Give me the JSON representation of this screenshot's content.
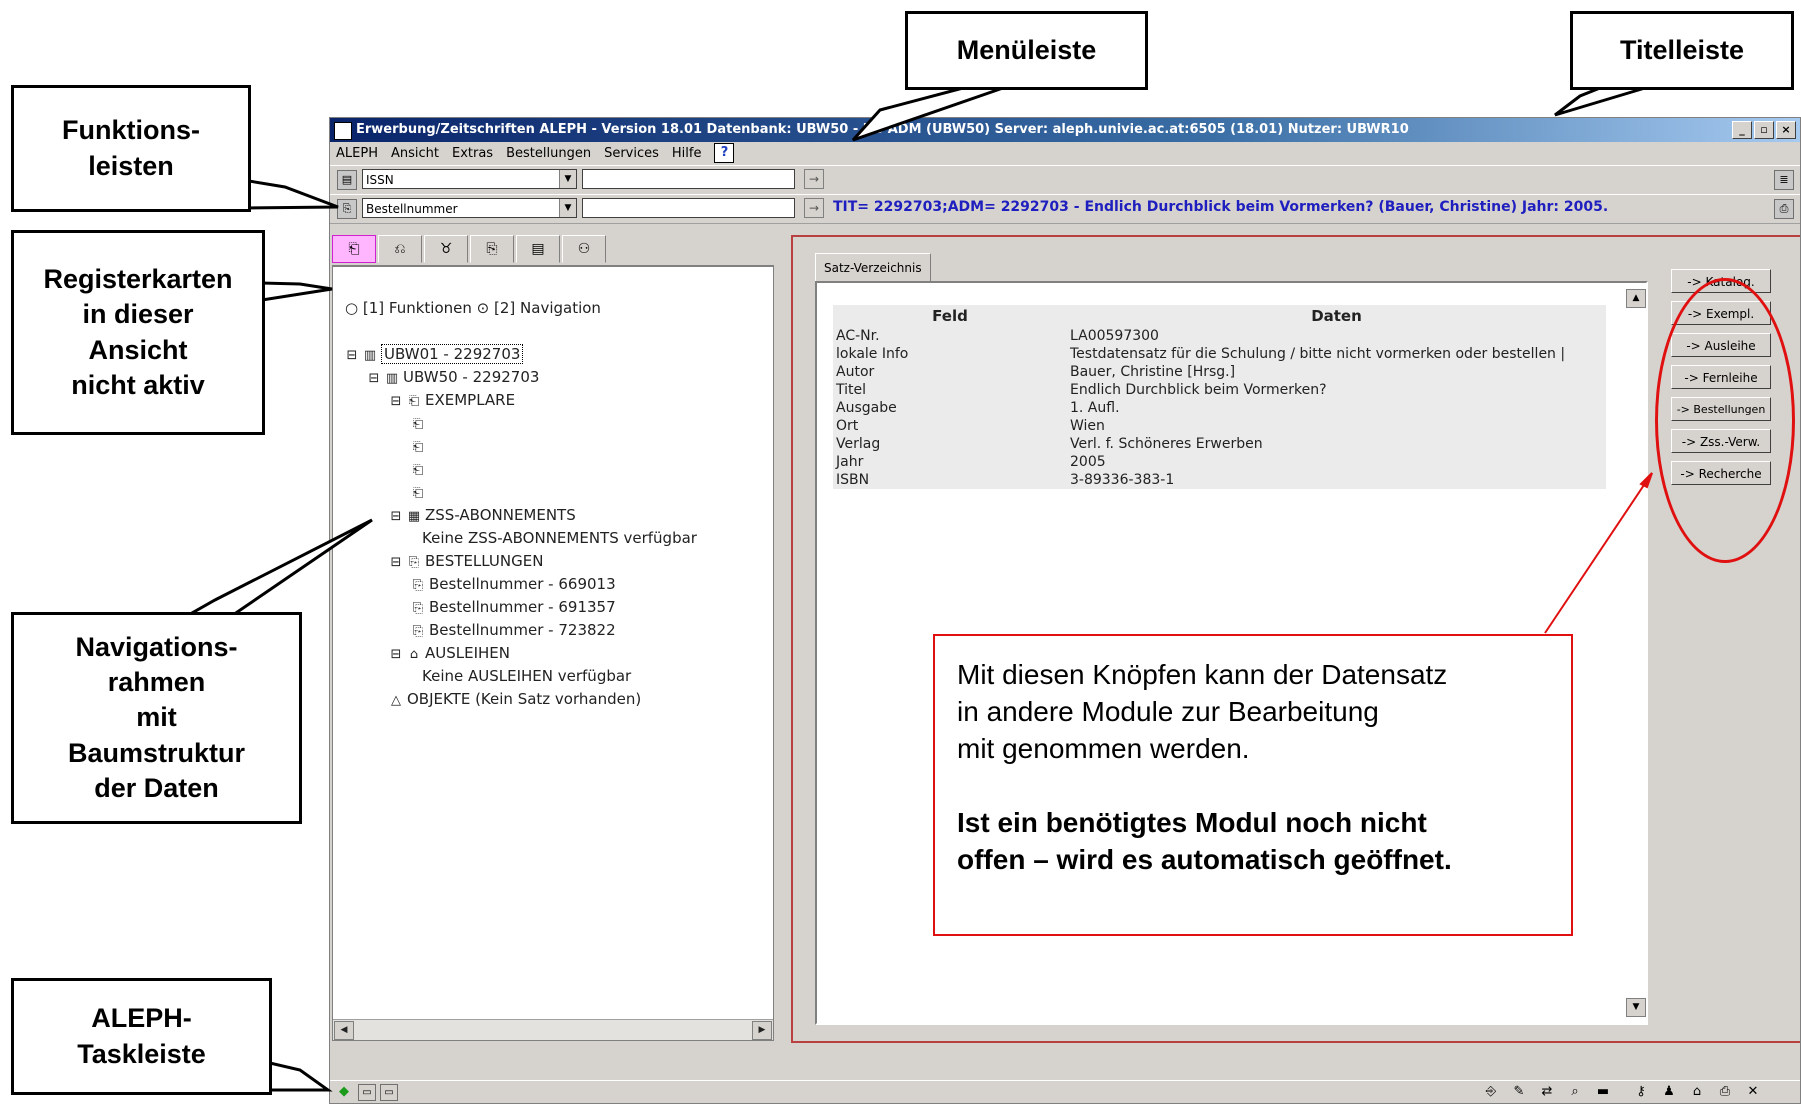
{
  "window": {
    "title": "Erwerbung/Zeitschriften ALEPH - Version 18.01  Datenbank: UBW50 - UB ADM (UBW50)  Server: aleph.univie.ac.at:6505 (18.01)  Nutzer: UBWR10",
    "controls": [
      "_",
      "▫",
      "×"
    ]
  },
  "menu": [
    "ALEPH",
    "Ansicht",
    "Extras",
    "Bestellungen",
    "Services",
    "Hilfe"
  ],
  "help_glyph": "?",
  "toolbar": {
    "row1_select": "ISSN",
    "row2_select": "Bestellnummer",
    "info_text": "TIT= 2292703;ADM= 2292703 - Endlich Durchblick beim Vormerken? (Bauer, Christine) Jahr: 2005.",
    "go_glyph": "→",
    "combo_arrow": "▼",
    "ellipsis": "..."
  },
  "nav_tabs": [
    "⎗",
    "⎌",
    "♉",
    "⎘",
    "▤",
    "⚇"
  ],
  "nav": {
    "radio1": "[1] Funktionen",
    "radio2": "[2] Navigation",
    "tree": [
      {
        "text": "UBW01 - 2292703",
        "icon": "▥",
        "exp": "⊟",
        "level": 0,
        "selected": true
      },
      {
        "text": "UBW50 - 2292703",
        "icon": "▥",
        "exp": "⊟",
        "level": 1
      },
      {
        "text": "EXEMPLARE",
        "icon": "⎗",
        "exp": "⊟",
        "level": 2
      },
      {
        "text": "",
        "icon": "⎗",
        "exp": "",
        "level": 3
      },
      {
        "text": "",
        "icon": "⎗",
        "exp": "",
        "level": 3
      },
      {
        "text": "",
        "icon": "⎗",
        "exp": "",
        "level": 3
      },
      {
        "text": "",
        "icon": "⎗",
        "exp": "",
        "level": 3
      },
      {
        "text": "ZSS-ABONNEMENTS",
        "icon": "▦",
        "exp": "⊟",
        "level": 2
      },
      {
        "text": "Keine ZSS-ABONNEMENTS verfügbar",
        "icon": "",
        "exp": "",
        "level": 3.5
      },
      {
        "text": "BESTELLUNGEN",
        "icon": "⎘",
        "exp": "⊟",
        "level": 2
      },
      {
        "text": "Bestellnummer - 669013",
        "icon": "⎘",
        "exp": "",
        "level": 3
      },
      {
        "text": "Bestellnummer - 691357",
        "icon": "⎘",
        "exp": "",
        "level": 3
      },
      {
        "text": "Bestellnummer - 723822",
        "icon": "⎘",
        "exp": "",
        "level": 3
      },
      {
        "text": "AUSLEIHEN",
        "icon": "⌂",
        "exp": "⊟",
        "level": 2
      },
      {
        "text": "Keine AUSLEIHEN verfügbar",
        "icon": "",
        "exp": "",
        "level": 3.5
      },
      {
        "text": "OBJEKTE (Kein Satz vorhanden)",
        "icon": "△",
        "exp": "",
        "level": 2
      }
    ]
  },
  "main": {
    "tab": "Satz-Verzeichnis",
    "headers": [
      "Feld",
      "Daten"
    ],
    "rows": [
      [
        "AC-Nr.",
        "LA00597300"
      ],
      [
        "lokale Info",
        "Testdatensatz für die Schulung / bitte nicht vormerken oder bestellen |"
      ],
      [
        "Autor",
        "Bauer, Christine [Hrsg.]"
      ],
      [
        "Titel",
        "Endlich Durchblick beim Vormerken?"
      ],
      [
        "Ausgabe",
        "1. Aufl."
      ],
      [
        "Ort",
        "Wien"
      ],
      [
        "Verlag",
        "Verl. f. Schöneres Erwerben"
      ],
      [
        "Jahr",
        "2005"
      ],
      [
        "ISBN",
        "3-89336-383-1"
      ]
    ],
    "side_buttons": [
      "-> Katalog.",
      "-> Exempl.",
      "-> Ausleihe",
      "-> Fernleihe",
      "-> Bestellungen",
      "-> Zss.-Verw.",
      "-> Recherche"
    ]
  },
  "callouts": {
    "menuleiste": "Menüleiste",
    "titelleiste": "Titelleiste",
    "funktionsleisten": "Funktions-\nleisten",
    "registerkarten": "Registerkarten\nin dieser\nAnsicht\nnicht aktiv",
    "navigationsrahmen": "Navigations-\nrahmen\nmit\nBaumstruktur\nder Daten",
    "taskleiste": "ALEPH-\nTaskleiste"
  },
  "note": {
    "line1": "Mit diesen Knöpfen kann der Datensatz",
    "line2": "in andere Module zur Bearbeitung",
    "line3": "mit genommen werden.",
    "bold1": "Ist ein benötigtes Modul noch nicht",
    "bold2": "offen – wird es automatisch geöffnet."
  },
  "colors": {
    "accent_red": "#e01010",
    "active_tab": "#ffb6ff",
    "info_blue": "#1f1fbf"
  }
}
